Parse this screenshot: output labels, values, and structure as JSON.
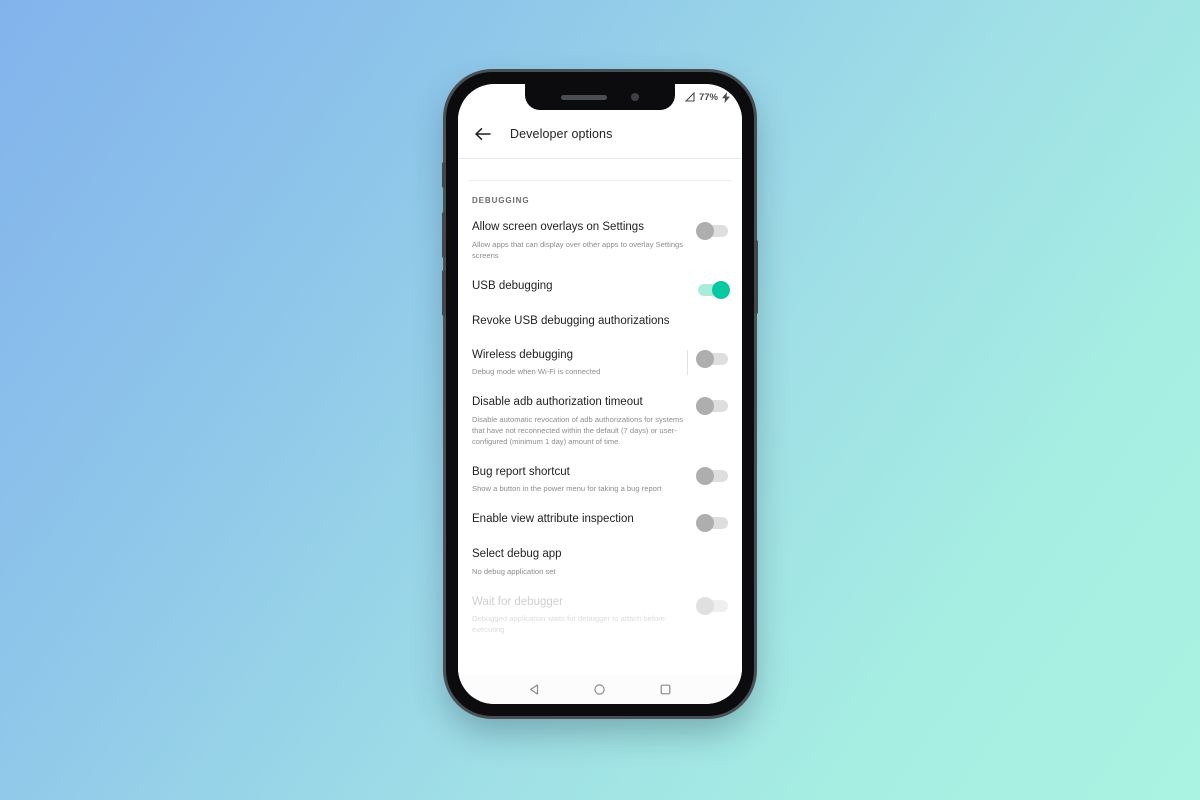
{
  "wallpaper": {
    "gradient_from": "#83b3ec",
    "gradient_to": "#aaf3e2"
  },
  "phone": {
    "notch": {
      "speaker_icon": "speaker-grille-icon",
      "camera_icon": "front-camera-icon"
    },
    "buttons": [
      "silent-switch",
      "volume-up-button",
      "volume-down-button",
      "power-button"
    ]
  },
  "status_bar": {
    "signal_icon": "signal-triangle-icon",
    "battery_percent": "77%",
    "charging_icon": "lightning-bolt-icon"
  },
  "header": {
    "back_icon": "back-arrow-icon",
    "title": "Developer options"
  },
  "section": {
    "label": "DEBUGGING"
  },
  "settings": [
    {
      "title": "Allow screen overlays on Settings",
      "desc": "Allow apps that can display over other apps to overlay Settings screens",
      "toggle": "off",
      "disabled": false,
      "divider": false
    },
    {
      "title": "USB debugging",
      "desc": "",
      "toggle": "on",
      "disabled": false,
      "divider": false
    },
    {
      "title": "Revoke USB debugging authorizations",
      "desc": "",
      "toggle": "none",
      "disabled": false,
      "divider": false
    },
    {
      "title": "Wireless debugging",
      "desc": "Debug mode when Wi-Fi is connected",
      "toggle": "off",
      "disabled": false,
      "divider": true
    },
    {
      "title": "Disable adb authorization timeout",
      "desc": "Disable automatic revocation of adb authorizations for systems that have not reconnected within the default (7 days) or user-configured (minimum 1 day) amount of time.",
      "toggle": "off",
      "disabled": false,
      "divider": false
    },
    {
      "title": "Bug report shortcut",
      "desc": "Show a button in the power menu for taking a bug report",
      "toggle": "off",
      "disabled": false,
      "divider": false
    },
    {
      "title": "Enable view attribute inspection",
      "desc": "",
      "toggle": "off",
      "disabled": false,
      "divider": false
    },
    {
      "title": "Select debug app",
      "desc": "No debug application set",
      "toggle": "none",
      "disabled": false,
      "divider": false
    },
    {
      "title": "Wait for debugger",
      "desc": "Debugged application waits for debugger to attach before executing",
      "toggle": "dim",
      "disabled": true,
      "divider": false
    }
  ],
  "nav_bar": {
    "back": "nav-back-triangle-icon",
    "home": "nav-home-circle-icon",
    "recents": "nav-recents-square-icon"
  },
  "colors": {
    "toggle_on": "#06c9a1",
    "toggle_on_track": "#a9ecdc",
    "toggle_off": "#aeaeae",
    "text_primary": "#1f1f1f",
    "text_secondary": "#8d8d8d"
  }
}
